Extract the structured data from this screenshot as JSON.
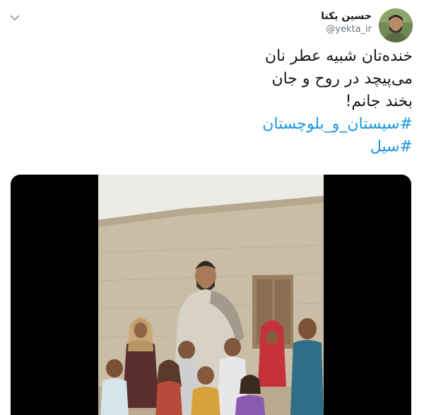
{
  "tweet": {
    "author": {
      "display_name": "حسین یکتا",
      "handle": "@yekta_ir"
    },
    "text_lines": [
      "خنده‌تان شبیه عطر نان",
      "می‌پیچد در روح و جان",
      "بخند جانم!"
    ],
    "hashtags": [
      "#سیستان_و_بلوچستان",
      "#سیل"
    ]
  },
  "icons": {
    "menu": "chevron-down-icon"
  }
}
